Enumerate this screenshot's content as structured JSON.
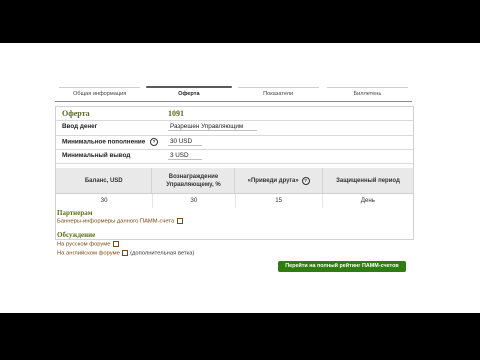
{
  "tabs": [
    "Общая информация",
    "Оферта",
    "Показатели",
    "Биллетень"
  ],
  "offer": {
    "title": "Оферта",
    "number": "1091"
  },
  "fields": [
    {
      "label": "Ввод денег",
      "value": "Разрешен Управляющим",
      "help": false
    },
    {
      "label": "Минимальное пополнение",
      "value": "30 USD",
      "help": true
    },
    {
      "label": "Минимальный вывод",
      "value": "3 USD",
      "help": false
    }
  ],
  "table": {
    "headers": [
      "Баланс, USD",
      "Вознаграждение Управляющему, %",
      "«Приведи друга»",
      "Защищенный период"
    ],
    "row": [
      "30",
      "30",
      "15",
      "День"
    ],
    "help_icon_on": "«Приведи друга»"
  },
  "partners": {
    "title": "Партнерам",
    "link": "Баннеры-информеры данного ПАММ-счета"
  },
  "discussion": {
    "title": "Обсуждение",
    "links": [
      {
        "text": "На русском форуме",
        "note": ""
      },
      {
        "text": "На английском форуме",
        "note": "(дополнительная ветка)"
      }
    ]
  },
  "button": {
    "label": "Перейти на полный рейтинг ПАММ-счетов"
  },
  "colors": {
    "accent_green": "#2f7d11",
    "title_olive": "#5a6b16",
    "link_brown": "#7a4a10"
  }
}
